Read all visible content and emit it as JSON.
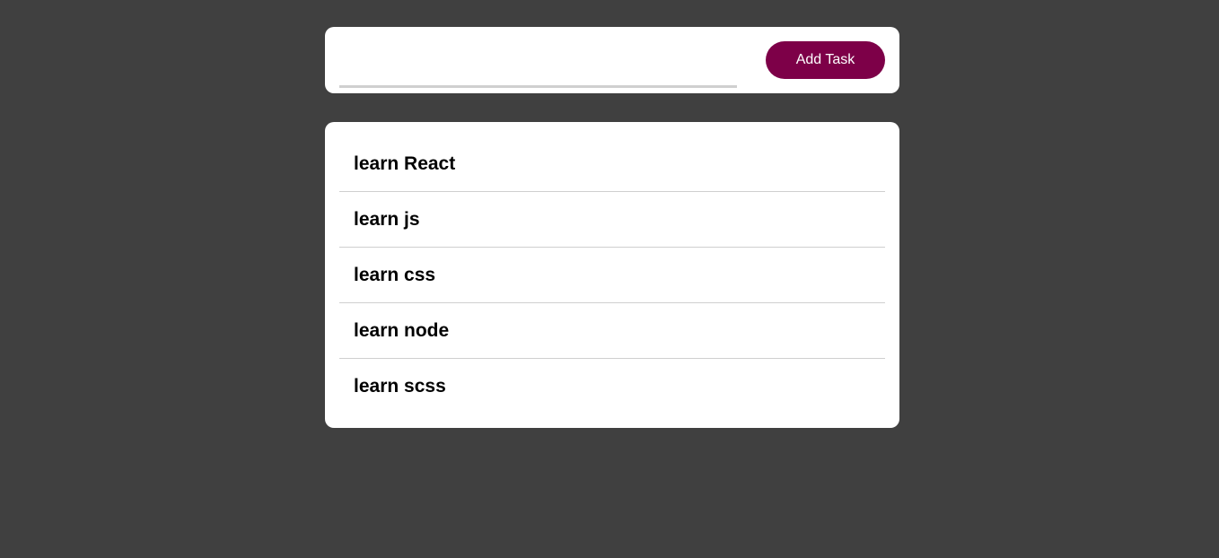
{
  "form": {
    "input_value": "",
    "input_placeholder": "",
    "add_button_label": "Add Task"
  },
  "tasks": [
    {
      "label": "learn React"
    },
    {
      "label": "learn js"
    },
    {
      "label": "learn css"
    },
    {
      "label": "learn node"
    },
    {
      "label": "learn scss"
    }
  ],
  "colors": {
    "background": "#404040",
    "card": "#ffffff",
    "accent": "#7d0048",
    "divider": "#cfcfcf"
  }
}
